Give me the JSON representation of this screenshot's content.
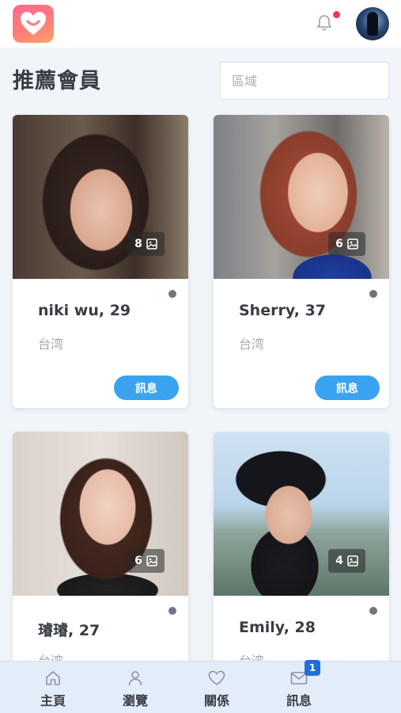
{
  "page": {
    "title": "推薦會員"
  },
  "search": {
    "placeholder": "區域"
  },
  "notifications": {
    "has_unread": true,
    "dot_color": "#f0394f"
  },
  "colors": {
    "accent": "#3aa3f0",
    "logo_start": "#ff6a8f",
    "logo_end": "#ffa266",
    "nav_bg": "#e3edf9",
    "badge": "#1f6ee0"
  },
  "members": [
    {
      "name_age": "niki wu, 29",
      "location": "台湾",
      "photo_count": "8",
      "message_label": "訊息"
    },
    {
      "name_age": "Sherry, 37",
      "location": "台湾",
      "photo_count": "6",
      "message_label": "訊息"
    },
    {
      "name_age": "璿璿, 27",
      "location": "台湾",
      "photo_count": "6"
    },
    {
      "name_age": "Emily, 28",
      "location": "台湾",
      "photo_count": "4"
    }
  ],
  "nav": {
    "items": [
      {
        "label": "主頁",
        "icon": "home-icon"
      },
      {
        "label": "瀏覽",
        "icon": "person-icon"
      },
      {
        "label": "關係",
        "icon": "heart-icon"
      },
      {
        "label": "訊息",
        "icon": "mail-icon",
        "badge": "1"
      }
    ]
  }
}
